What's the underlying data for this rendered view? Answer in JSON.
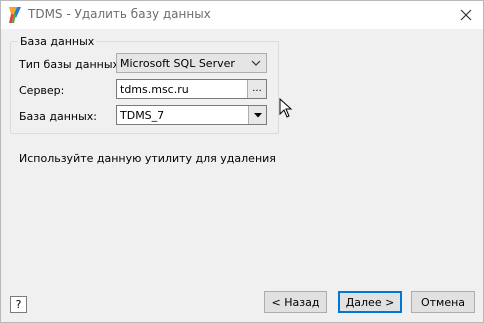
{
  "window": {
    "title": "TDMS - Удалить базу данных"
  },
  "group": {
    "title": "База данных",
    "db_type_label": "Тип базы данных:",
    "db_type_value": "Microsoft SQL Server",
    "server_label": "Сервер:",
    "server_value": "tdms.msc.ru",
    "browse_label": "...",
    "database_label": "База данных:",
    "database_value": "TDMS_7"
  },
  "info": "Используйте данную утилиту для удаления",
  "footer": {
    "help_label": "?",
    "back_label": "< Назад",
    "next_label": "Далее >",
    "cancel_label": "Отмена"
  },
  "colors": {
    "accent": "#0078d7",
    "window_bg": "#f0f0f0",
    "title_text": "#6d6d6d"
  },
  "icons": [
    "app-logo-icon",
    "close-icon",
    "chevron-down-icon",
    "dropdown-arrow-icon",
    "mouse-pointer-icon"
  ]
}
